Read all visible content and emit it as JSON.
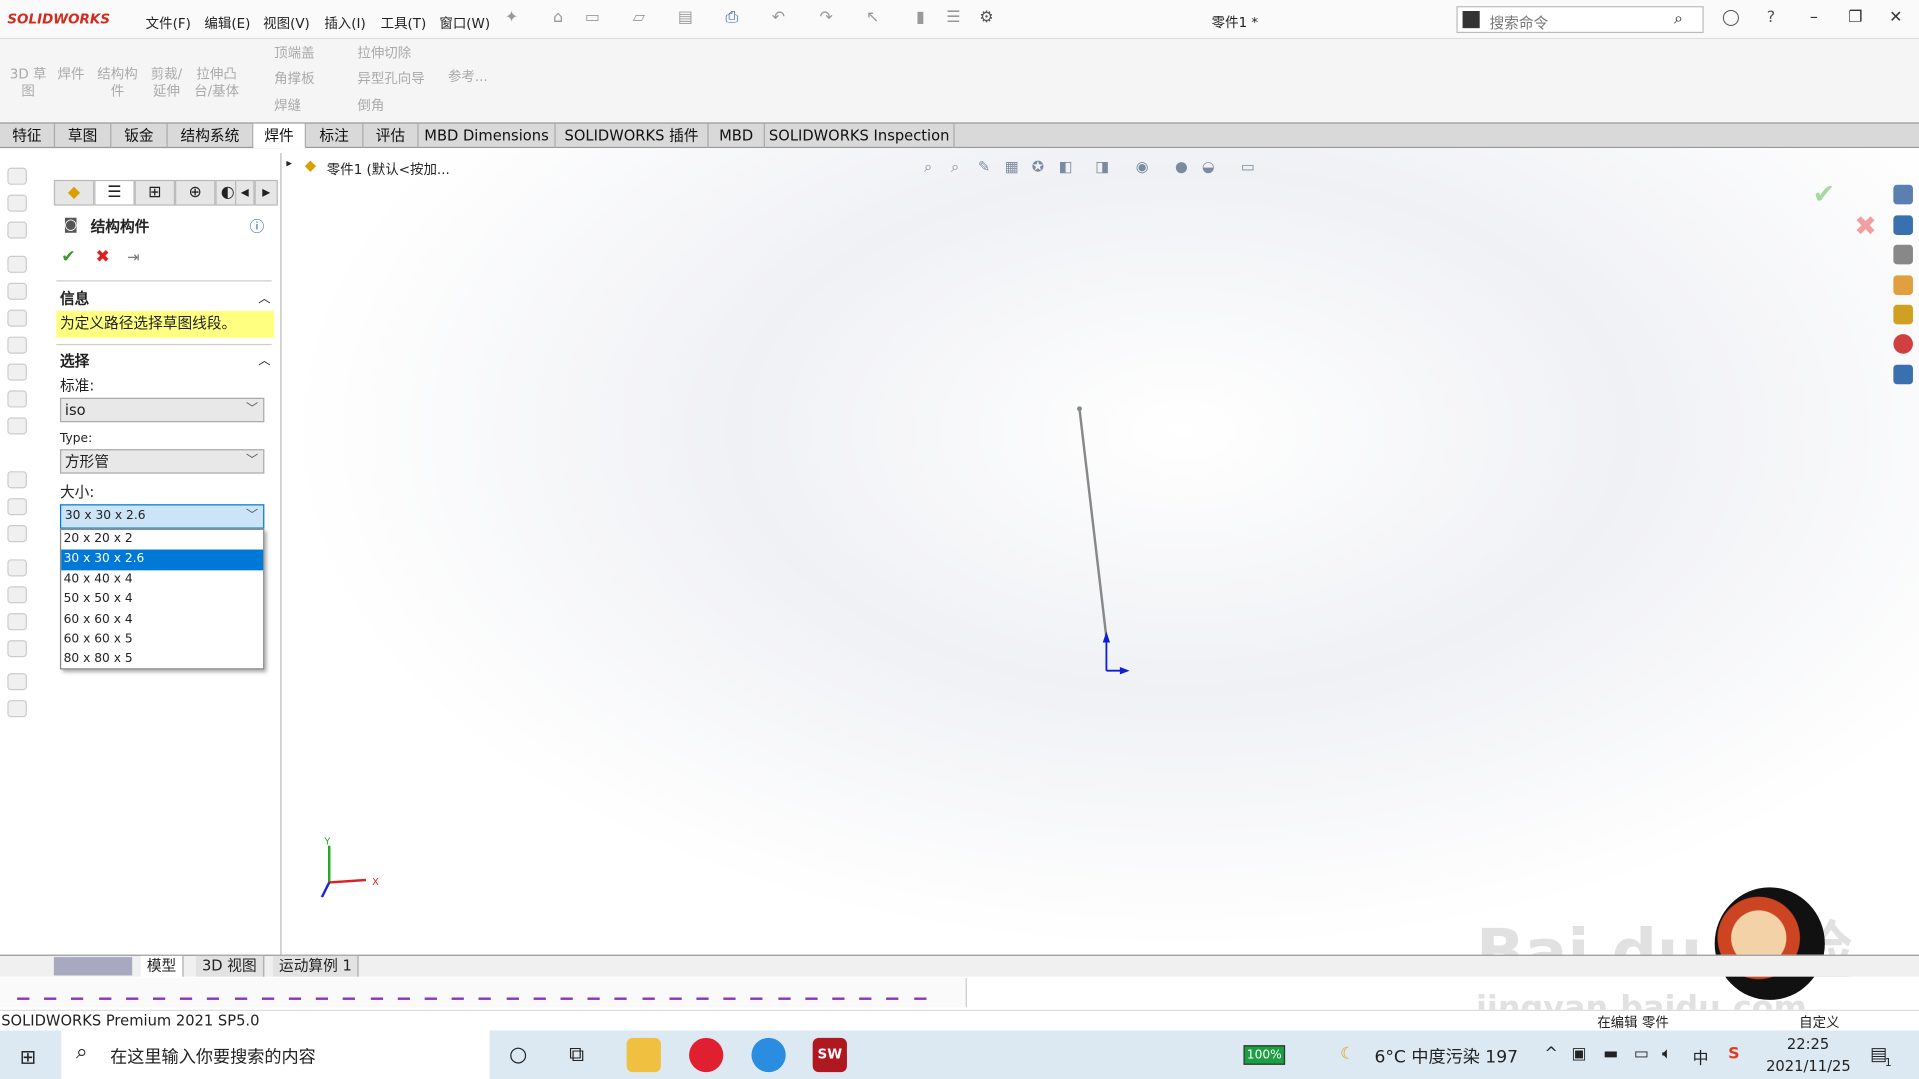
{
  "app": {
    "logo": "SOLIDWORKS",
    "title": "零件1 *",
    "search_placeholder": "搜索命令"
  },
  "menu": [
    "文件(F)",
    "编辑(E)",
    "视图(V)",
    "插入(I)",
    "工具(T)",
    "窗口(W)"
  ],
  "command_manager": {
    "large": [
      "3D 草图",
      "焊件",
      "结构构件",
      "剪裁/延伸",
      "拉伸凸台/基体"
    ],
    "small_col1": [
      "顶端盖",
      "角撑板",
      "焊缝"
    ],
    "small_col2": [
      "拉伸切除",
      "异型孔向导",
      "倒角"
    ],
    "reference": "参考..."
  },
  "tabs": [
    "特征",
    "草图",
    "钣金",
    "结构系统",
    "焊件",
    "标注",
    "评估",
    "MBD Dimensions",
    "SOLIDWORKS 插件",
    "MBD",
    "SOLIDWORKS Inspection"
  ],
  "active_tab": "焊件",
  "feature_tree": {
    "root": "零件1 (默认<按加..."
  },
  "property_manager": {
    "title": "结构构件",
    "info": {
      "header": "信息",
      "message": "为定义路径选择草图线段。"
    },
    "selection": {
      "header": "选择",
      "standard_label": "标准:",
      "standard_value": "iso",
      "type_label": "Type:",
      "type_value": "方形管",
      "size_label": "大小:",
      "size_value": "30 x 30 x 2.6",
      "size_options": [
        "20 x 20 x 2",
        "30 x 30 x 2.6",
        "40 x 40 x 4",
        "50 x 50 x 4",
        "60 x 60 x 4",
        "60 x 60 x 5",
        "80 x 80 x 5"
      ],
      "selected_option": "30 x 30 x 2.6"
    }
  },
  "triad": {
    "x": "X",
    "y": "Y"
  },
  "bottom_tabs": [
    "模型",
    "3D 视图",
    "运动算例 1"
  ],
  "status": {
    "left": "SOLIDWORKS Premium 2021 SP5.0",
    "editing": "在编辑 零件",
    "custom": "自定义"
  },
  "taskbar": {
    "search_placeholder": "在这里输入你要搜索的内容",
    "battery": "100%",
    "weather": "6°C 中度污染 197",
    "time": "22:25",
    "date": "2021/11/25",
    "notifications": "1",
    "ime": "中"
  },
  "watermark": {
    "text": "Baidu经验",
    "url": "jingyan.baidu.com"
  },
  "colors": {
    "accent": "#0078d7",
    "info_bg": "#ffff80",
    "logo": "#d52b1e"
  }
}
